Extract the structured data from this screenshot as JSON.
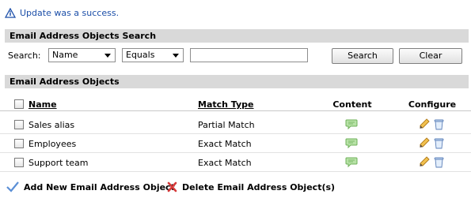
{
  "notice": {
    "message": "Update was a success.",
    "icon": "info-icon"
  },
  "search_section": {
    "title": "Email Address Objects Search",
    "label": "Search:",
    "field_select": "Name",
    "operator_select": "Equals",
    "query": "",
    "search_button": "Search",
    "clear_button": "Clear"
  },
  "objects_section": {
    "title": "Email Address Objects",
    "columns": {
      "name": "Name",
      "match_type": "Match Type",
      "content": "Content",
      "configure": "Configure"
    },
    "rows": [
      {
        "name": "Sales alias",
        "match_type": "Partial Match"
      },
      {
        "name": "Employees",
        "match_type": "Exact Match"
      },
      {
        "name": "Support team",
        "match_type": "Exact Match"
      }
    ]
  },
  "actions": {
    "add": "Add New Email Address Object",
    "delete": "Delete Email Address Object(s)"
  },
  "colors": {
    "notice_text": "#1b4ea8",
    "section_bar": "#d9d9d9",
    "delete_x": "#d63a3a",
    "add_check": "#5b8fd6"
  }
}
